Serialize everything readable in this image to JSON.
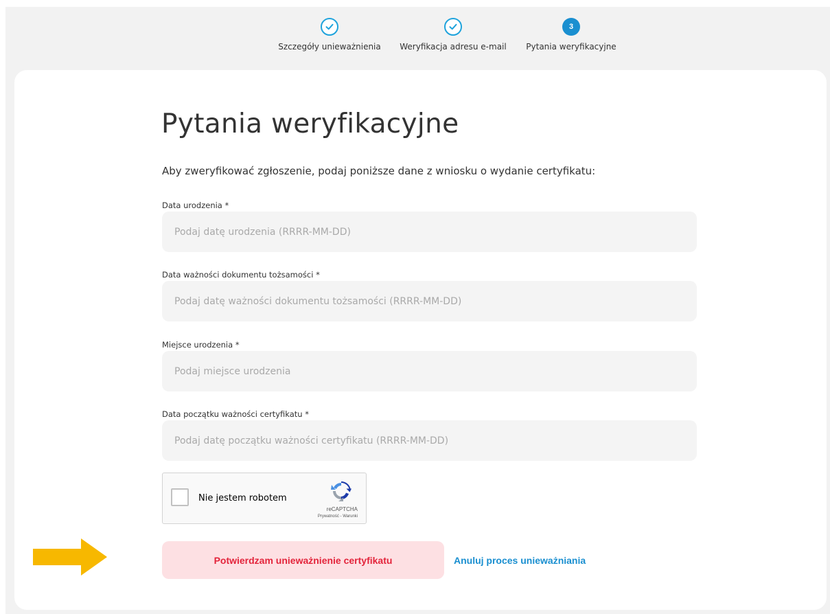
{
  "stepper": {
    "steps": [
      {
        "label": "Szczegóły unieważnienia",
        "state": "done",
        "icon": "check-icon"
      },
      {
        "label": "Weryfikacja adresu e-mail",
        "state": "done",
        "icon": "check-icon"
      },
      {
        "label": "Pytania weryfikacyjne",
        "state": "current",
        "number": "3"
      }
    ]
  },
  "main": {
    "title": "Pytania weryfikacyjne",
    "intro": "Aby zweryfikować zgłoszenie, podaj poniższe dane z wniosku o wydanie certyfikatu:"
  },
  "form": {
    "fields": [
      {
        "label": "Data urodzenia *",
        "placeholder": "Podaj datę urodzenia (RRRR-MM-DD)",
        "value": ""
      },
      {
        "label": "Data ważności dokumentu tożsamości *",
        "placeholder": "Podaj datę ważności dokumentu tożsamości (RRRR-MM-DD)",
        "value": ""
      },
      {
        "label": "Miejsce urodzenia *",
        "placeholder": "Podaj miejsce urodzenia",
        "value": ""
      },
      {
        "label": "Data początku ważności certyfikatu *",
        "placeholder": "Podaj datę początku ważności certyfikatu (RRRR-MM-DD)",
        "value": ""
      }
    ]
  },
  "recaptcha": {
    "checkbox_label": "Nie jestem robotem",
    "brand": "reCAPTCHA",
    "terms": "Prywatność - Warunki",
    "checked": false
  },
  "actions": {
    "confirm_label": "Potwierdzam unieważnienie certyfikatu",
    "cancel_label": "Anuluj proces unieważniania"
  },
  "colors": {
    "accent": "#1a8fd0",
    "danger": "#e3243b",
    "danger_bg": "#fde0e3",
    "arrow": "#f7b800"
  }
}
